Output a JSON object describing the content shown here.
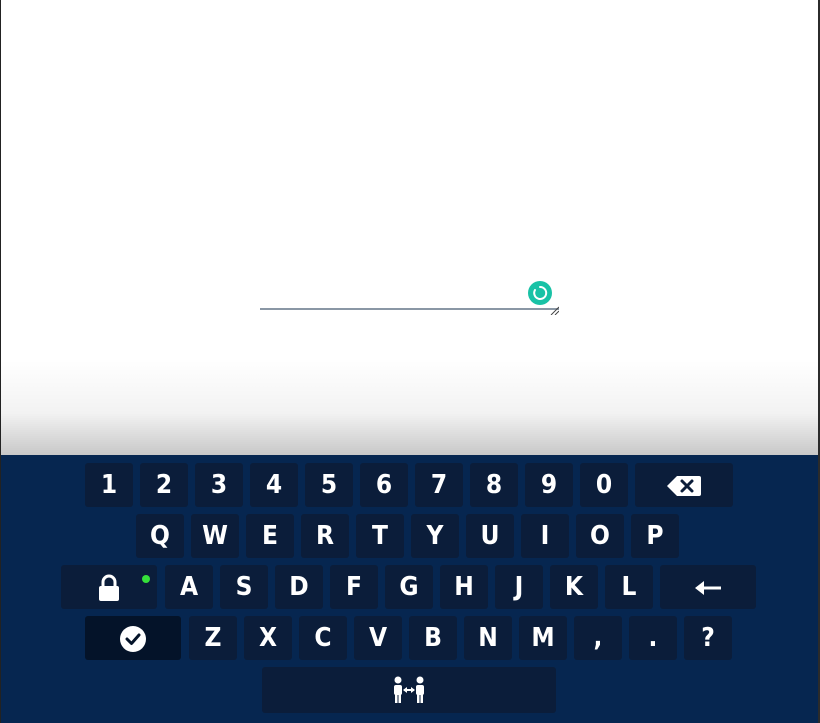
{
  "keyboard": {
    "number_row": [
      "1",
      "2",
      "3",
      "4",
      "5",
      "6",
      "7",
      "8",
      "9",
      "0"
    ],
    "row_q": [
      "Q",
      "W",
      "E",
      "R",
      "T",
      "Y",
      "U",
      "I",
      "O",
      "P"
    ],
    "row_a": [
      "A",
      "S",
      "D",
      "F",
      "G",
      "H",
      "J",
      "K",
      "L"
    ],
    "row_z": [
      "Z",
      "X",
      "C",
      "V",
      "B",
      "N",
      "M",
      ",",
      ".",
      "?"
    ],
    "icons": {
      "backspace": "backspace-icon",
      "lock": "lock-icon",
      "enter": "enter-arrow-icon",
      "accept": "checkmark-icon",
      "space": "swap-users-icon"
    },
    "colors": {
      "background": "#062650",
      "key": "#0b1d3a",
      "key_text": "#ffffff",
      "lock_indicator": "#35e03a"
    }
  },
  "text_area": {
    "value": "",
    "spinner_color": "#19c2a6"
  }
}
